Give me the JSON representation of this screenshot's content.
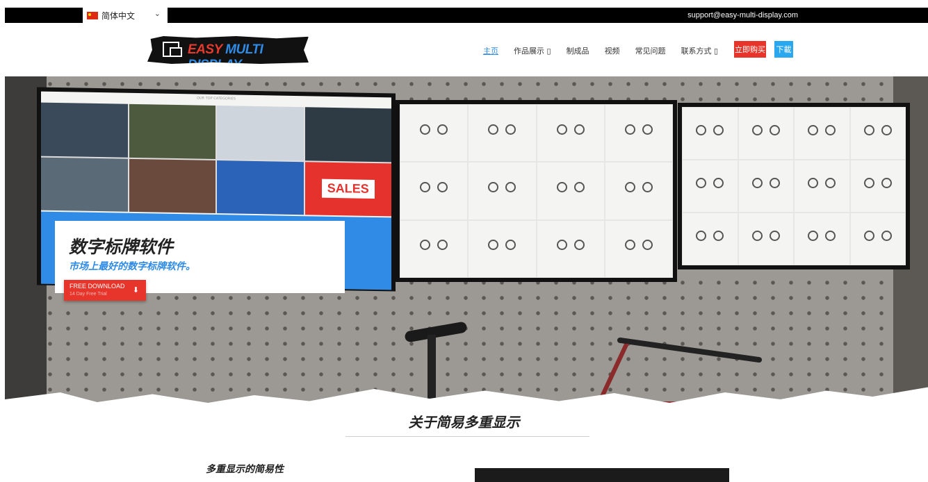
{
  "topbar": {
    "language": "简体中文",
    "email": "support@easy-multi-display.com"
  },
  "logo": {
    "part1": "EASY",
    "part2": " MULTI DISPLAY"
  },
  "nav": {
    "items": [
      "主页",
      "作品展示 ▯",
      "制成品",
      "视频",
      "常见问题",
      "联系方式 ▯"
    ],
    "buy": "立即购买",
    "download": "下載"
  },
  "hero": {
    "screen_banner": "OUR TOP CATEGORIES",
    "sales": "SALES",
    "title": "数字标牌软件",
    "subtitle": "市场上最好的数字标牌软件。",
    "button_label": "FREE DOWNLOAD",
    "button_sub": "14 Day Free Trial"
  },
  "about": {
    "title": "关于简易多重显示",
    "subtitle": "多重显示的简易性"
  },
  "colors": {
    "accent_red": "#e8352b",
    "accent_blue": "#2f8be6"
  }
}
